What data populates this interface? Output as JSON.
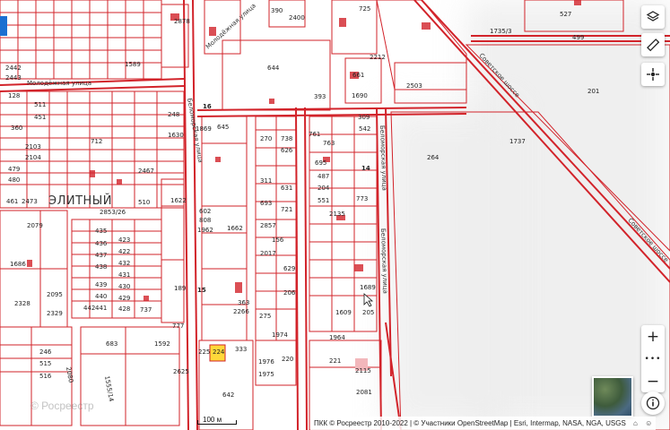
{
  "district_label": "ЭЛИТНЫЙ",
  "streets": {
    "molodezhnaya_top": "Молодёжная улица",
    "molodezhnaya_left": "Молодёжная улица",
    "belomorskaya_1": "Беломорская улица",
    "belomorskaya_2": "Беломорская улица",
    "belomorskaya_3": "Беломорская улица",
    "sovetskoe_1": "Советское шоссе",
    "sovetskoe_2": "Советское шоссе"
  },
  "parcels": {
    "p1": "2878",
    "p2": "390",
    "p3": "2400",
    "p4": "725",
    "p5": "527",
    "p6": "1735/3",
    "p7": "499",
    "p8": "644",
    "p9": "661",
    "p10": "2212",
    "p11": "2503",
    "p12": "201",
    "p13": "1690",
    "p14": "1737",
    "p15": "264",
    "p16": "309",
    "p17": "542",
    "p18": "14",
    "p19": "270",
    "p20": "738",
    "p21": "626",
    "p22": "695",
    "p23": "487",
    "p24": "204",
    "p25": "551",
    "p26": "311",
    "p27": "631",
    "p28": "693",
    "p29": "721",
    "p30": "773",
    "p31": "2135",
    "p32": "2857",
    "p33": "156",
    "p34": "2017",
    "p35": "629",
    "p36": "206",
    "p37": "1689",
    "p38": "1609",
    "p39": "205",
    "p40": "1974",
    "p41": "1964",
    "p42": "1976",
    "p43": "220",
    "p44": "221",
    "p45": "1975",
    "p46": "2115",
    "p47": "2081",
    "p48": "642",
    "p49": "225",
    "p50": "224",
    "p51": "333",
    "p52": "1592",
    "p53": "683",
    "p54": "2625",
    "p55": "1555/14",
    "p56": "2080",
    "p57": "1662",
    "p58": "602",
    "p59": "808",
    "p60": "1962",
    "p61": "1622",
    "p62": "2853/26",
    "p63": "2079",
    "p64": "1686",
    "p65": "2328",
    "p66": "2095",
    "p67": "2329",
    "p68": "2473",
    "p69": "461",
    "p70": "360",
    "p71": "2103",
    "p72": "2104",
    "p73": "479",
    "p74": "480",
    "p75": "128",
    "p76": "511",
    "p77": "451",
    "p78": "2442",
    "p79": "2443",
    "p80": "1589",
    "p81": "1869",
    "p82": "645",
    "p83": "248",
    "p84": "1630",
    "p85": "712",
    "p86": "2467",
    "p87": "510",
    "p88": "435",
    "p89": "436",
    "p90": "437",
    "p91": "438",
    "p92": "439",
    "p93": "440",
    "p94": "441",
    "p95": "442",
    "p96": "423",
    "p97": "422",
    "p98": "432",
    "p99": "431",
    "p100": "430",
    "p101": "429",
    "p102": "428",
    "p103": "737",
    "p104": "189",
    "p105": "15",
    "p106": "363",
    "p107": "2266",
    "p108": "275",
    "p109": "777",
    "p110": "515",
    "p111": "516",
    "p112": "246",
    "p113": "761",
    "p114": "763",
    "p115": "393",
    "p116": "16"
  },
  "controls": {
    "layers_icon": "layers-icon",
    "ruler_icon": "ruler-icon",
    "locate_icon": "crosshair-icon",
    "zoom_in": "+",
    "more": "•••",
    "zoom_out": "−",
    "info_icon": "info-icon"
  },
  "scale_label": "100 м",
  "attribution": "ПКК © Росреестр 2010-2022 | © Участники OpenStreetMap | Esri, Intermap, NASA, NGA, USGS",
  "watermark": "© Росреестр",
  "colors": {
    "parcel_line": "#d2232a",
    "highlight": "#ffd83a",
    "background": "#ffffff"
  }
}
